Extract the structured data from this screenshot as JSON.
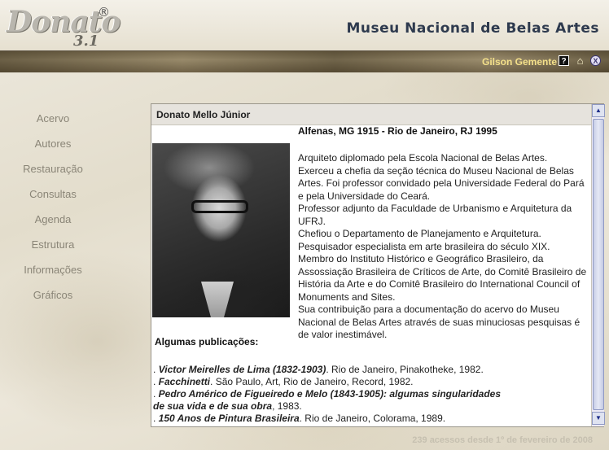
{
  "app": {
    "logo_text": "Donato",
    "logo_reg": "®",
    "logo_version": "3.1",
    "museum_title": "Museu Nacional de Belas Artes"
  },
  "toolbar": {
    "user_name": "Gilson Gemente",
    "help_icon": "?",
    "home_icon": "⌂",
    "exit_icon": "X"
  },
  "nav": {
    "items": [
      {
        "label": "Acervo"
      },
      {
        "label": "Autores"
      },
      {
        "label": "Restauração"
      },
      {
        "label": "Consultas"
      },
      {
        "label": "Agenda"
      },
      {
        "label": "Estrutura"
      },
      {
        "label": "Informações"
      },
      {
        "label": "Gráficos"
      }
    ]
  },
  "author": {
    "name": "Donato Mello Júnior",
    "birth_death": "Alfenas, MG 1915 - Rio de Janeiro, RJ 1995",
    "bio": [
      "Arquiteto diplomado pela Escola Nacional de Belas Artes.",
      "Exerceu a chefia da seção técnica do Museu Nacional de Belas Artes. Foi professor convidado pela Universidade Federal do Pará e pela Universidade do Ceará.",
      "Professor adjunto da Faculdade de Urbanismo e Arquitetura da UFRJ.",
      "Chefiou o Departamento de Planejamento e Arquitetura.",
      "Pesquisador especialista em arte brasileira do século XIX.",
      "Membro do Instituto Histórico e Geográfico Brasileiro, da Assossiação Brasileira de Críticos de Arte, do Comitê Brasileiro de História da Arte e do Comitê Brasileiro do International Council of Monuments and Sites.",
      "Sua contribuição para a documentação do acervo do Museu Nacional de Belas Artes através de suas minuciosas pesquisas é de valor inestimável."
    ],
    "publications_title": "Algumas publicações:",
    "publications": [
      {
        "title": "Victor Meirelles de Lima (1832-1903)",
        "rest": ". Rio de Janeiro, Pinakotheke, 1982."
      },
      {
        "title": "Facchinetti",
        "rest": ". São Paulo, Art, Rio de Janeiro, Record, 1982."
      },
      {
        "title": "Pedro Américo de Figueiredo e Melo (1843-1905): algumas singularidades de sua vida e de sua obra",
        "rest": ", 1983."
      },
      {
        "title": "150 Anos de Pintura Brasileira",
        "rest": ". Rio de Janeiro, Colorama, 1989."
      }
    ]
  },
  "scroll": {
    "up": "▲",
    "down": "▼"
  },
  "footer": {
    "access_count": "239 acessos desde 1º de fevereiro de 2008"
  }
}
